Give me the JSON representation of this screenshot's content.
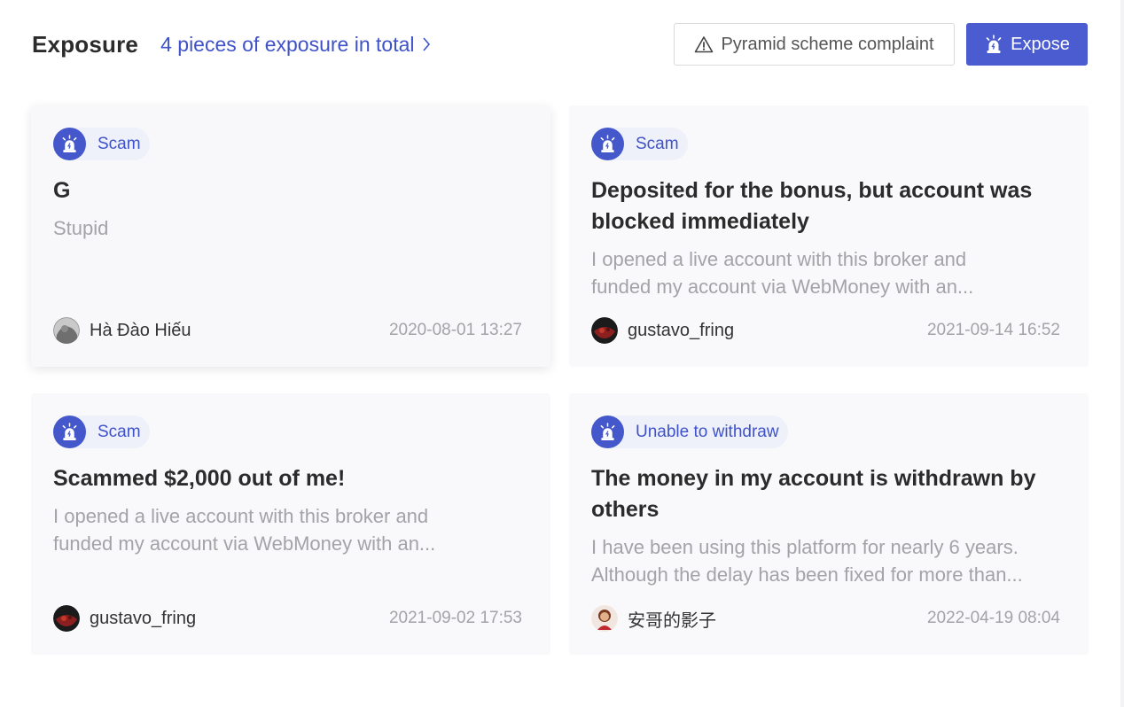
{
  "header": {
    "title": "Exposure",
    "total_link": "4 pieces of exposure in total",
    "pyramid_button": "Pyramid scheme complaint",
    "expose_button": "Expose"
  },
  "colors": {
    "accent": "#4b5cd1",
    "tag_background": "#eef0fa",
    "muted_text": "#a3a3a8"
  },
  "cards": [
    {
      "tag": "Scam",
      "title": "G",
      "text": [
        "Stupid"
      ],
      "author": "Hà Đào Hiếu",
      "date": "2020-08-01 13:27",
      "avatar_icon": "grey-photo-avatar"
    },
    {
      "tag": "Scam",
      "title": "Deposited for the bonus, but account was blocked immediately",
      "text": [
        "I opened a live account with this broker and",
        "funded my account via WebMoney with an..."
      ],
      "author": "gustavo_fring",
      "date": "2021-09-14 16:52",
      "avatar_icon": "dark-red-avatar"
    },
    {
      "tag": "Scam",
      "title": "Scammed $2,000 out of me!",
      "text": [
        "I opened a live account with this broker and",
        "funded my account via WebMoney with an..."
      ],
      "author": "gustavo_fring",
      "date": "2021-09-02 17:53",
      "avatar_icon": "dark-red-avatar"
    },
    {
      "tag": "Unable to withdraw",
      "title": "The money in my account is withdrawn by others",
      "text": [
        "I have been using this platform for nearly 6 years.",
        "Although the delay has been fixed for more than..."
      ],
      "author": "安哥的影子",
      "date": "2022-04-19 08:04",
      "avatar_icon": "cartoon-character-avatar"
    }
  ]
}
